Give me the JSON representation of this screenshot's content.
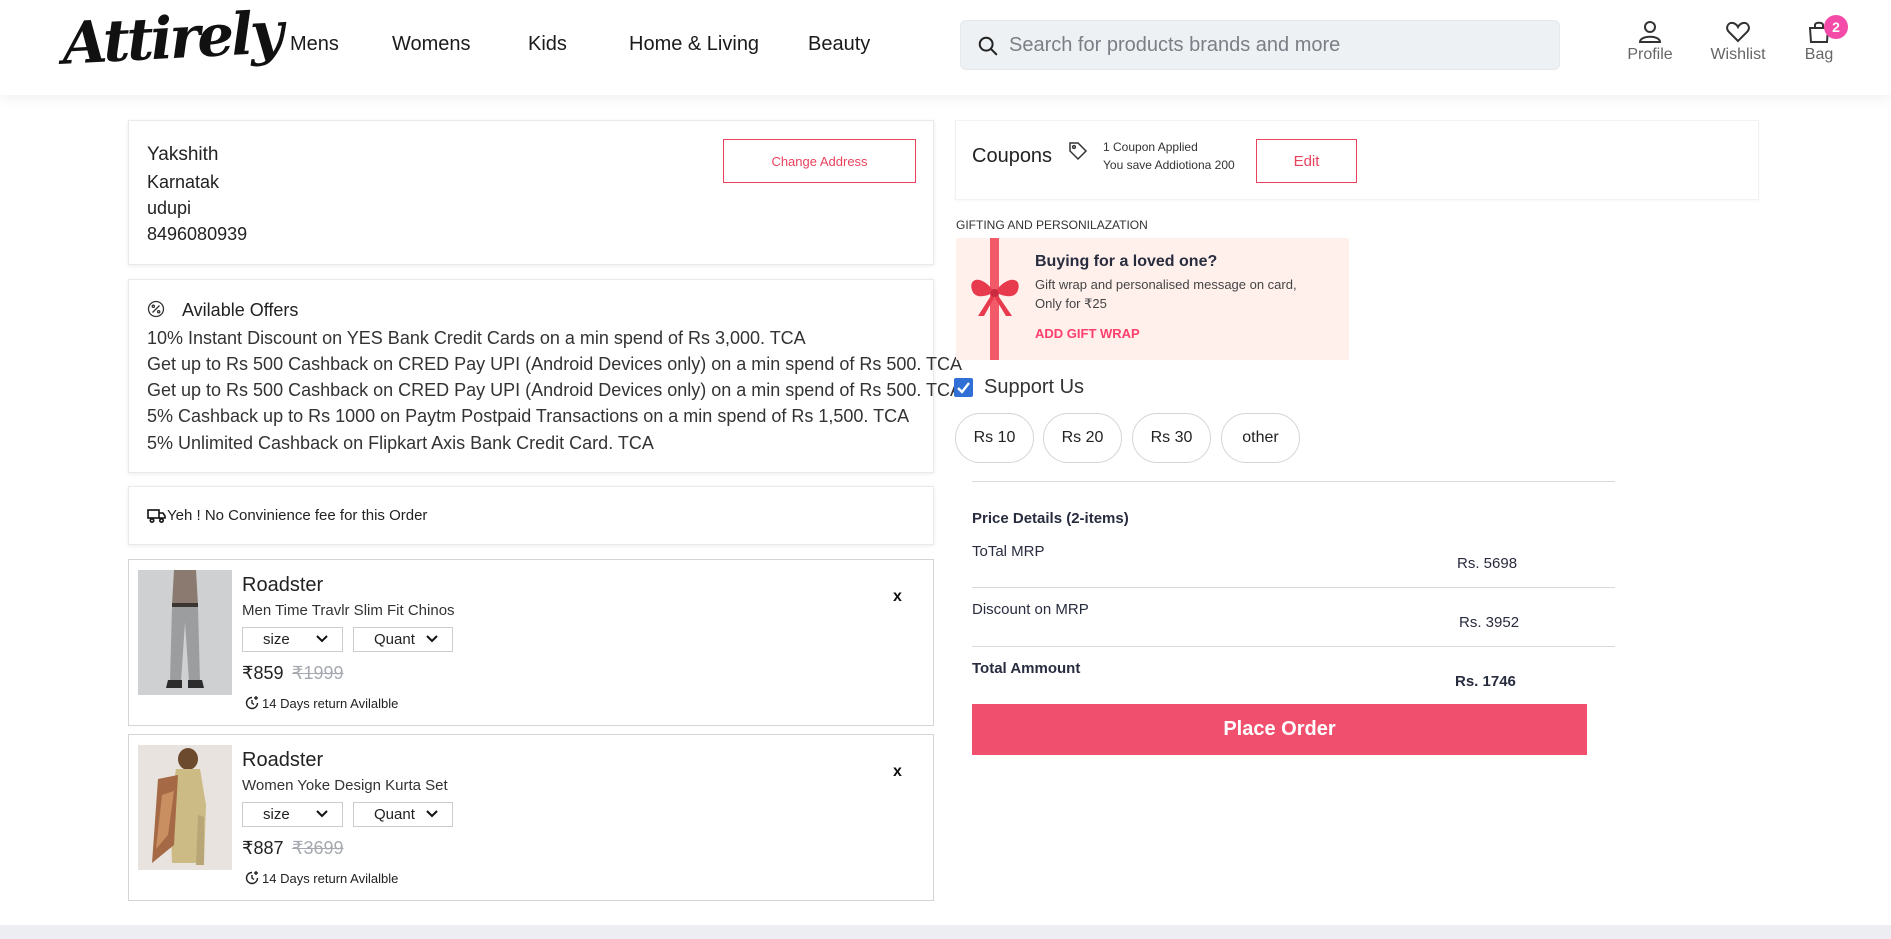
{
  "brand": {
    "logo": "Attirely"
  },
  "nav": {
    "links": [
      "Mens",
      "Womens",
      "Kids",
      "Home & Living",
      "Beauty"
    ],
    "search_placeholder": "Search for products brands and more",
    "profile": "Profile",
    "wishlist": "Wishlist",
    "bag": "Bag",
    "bag_count": "2"
  },
  "address": {
    "name": "Yakshith",
    "state": "Karnatak",
    "city": "udupi",
    "phone": "8496080939",
    "change_label": "Change Address"
  },
  "offers": {
    "title": "Avilable Offers",
    "items": [
      "10% Instant Discount on YES Bank Credit Cards on a min spend of Rs 3,000. TCA",
      "Get up to Rs 500 Cashback on CRED Pay UPI (Android Devices only) on a min spend of Rs 500. TCA",
      "Get up to Rs 500 Cashback on CRED Pay UPI (Android Devices only) on a min spend of Rs 500. TCA",
      "5% Cashback up to Rs 1000 on Paytm Postpaid Transactions on a min spend of Rs 1,500. TCA",
      "5% Unlimited Cashback on Flipkart Axis Bank Credit Card. TCA"
    ]
  },
  "convenience": {
    "text": "Yeh ! No Convinience fee for this Order"
  },
  "cart": [
    {
      "brand": "Roadster",
      "description": "Men Time Travlr Slim Fit Chinos",
      "size_label": "size",
      "qty_label": "Quant",
      "price": "₹859",
      "mrp": "₹1999",
      "return_text": "14 Days return Avilalble",
      "remove": "x"
    },
    {
      "brand": "Roadster",
      "description": "Women Yoke Design Kurta Set",
      "size_label": "size",
      "qty_label": "Quant",
      "price": "₹887",
      "mrp": "₹3699",
      "return_text": "14 Days return Avilalble",
      "remove": "x"
    }
  ],
  "coupons": {
    "title": "Coupons",
    "applied": "1 Coupon Applied",
    "savings": "You save Addiotiona 200",
    "edit_label": "Edit"
  },
  "gifting": {
    "section_title": "GIFTING AND PERSONILAZATION",
    "heading": "Buying for a loved one?",
    "line1": "Gift wrap and personalised message on card,",
    "line2": "Only for ₹25",
    "cta": "ADD GIFT WRAP"
  },
  "support": {
    "label": "Support Us",
    "checked": true,
    "amounts": [
      "Rs 10",
      "Rs 20",
      "Rs 30",
      "other"
    ]
  },
  "price_details": {
    "title": "Price Details (2-items)",
    "total_mrp_label": "ToTal MRP",
    "total_mrp_value": "Rs. 5698",
    "discount_label": "Discount on MRP",
    "discount_value": "Rs. 3952",
    "total_amount_label": "Total Ammount",
    "total_amount_value": "Rs. 1746",
    "place_order": "Place Order"
  },
  "colors": {
    "accent": "#f0506e",
    "badge": "#f44ba8",
    "gift_bg": "#fff0ec",
    "checkbox": "#2f6fd6"
  }
}
